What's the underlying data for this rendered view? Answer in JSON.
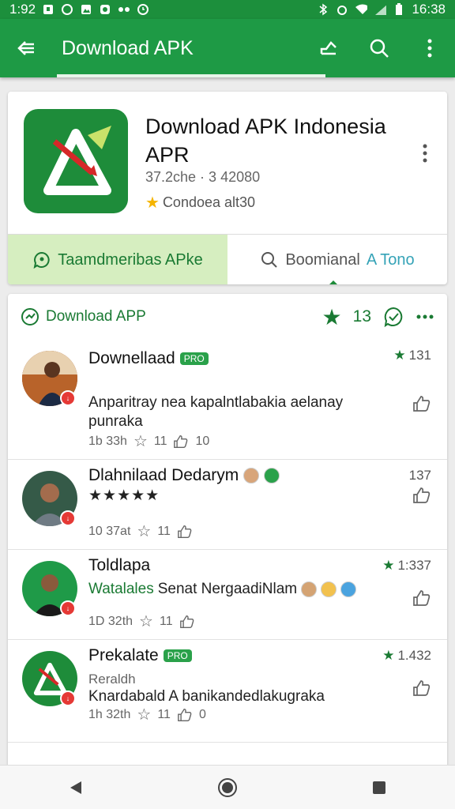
{
  "status_bar": {
    "time_left": "1:92",
    "time_right": "16:38",
    "icons_left": [
      "notification-icon",
      "music-icon",
      "image-icon",
      "app-icon",
      "dots-icon",
      "alarm-icon"
    ],
    "icons_right": [
      "bluetooth-icon",
      "alarm-icon",
      "wifi-icon",
      "signal-icon",
      "battery-icon"
    ]
  },
  "app_bar": {
    "title": "Download APK",
    "back_icon": "arrow-left-icon",
    "share_icon": "share-icon",
    "search_icon": "search-icon",
    "more_icon": "more-vert-icon",
    "color": "#1e9a45"
  },
  "app_card": {
    "name": "Download APK Indonesia APR",
    "meta": "37.2che · 3 42080",
    "rating_text": "Condoea alt30",
    "tabs": {
      "active_label": "Taamdmeribas APke",
      "search_label": "Boomianal",
      "search_label_teal": "A Tono"
    }
  },
  "list": {
    "header_title": "Download APP",
    "header_count": "13",
    "items": [
      {
        "name": "Downellaad",
        "tag": "PRO",
        "score": "131",
        "desc": "Anparitray nea kapalntlabakiа aelanay punraka",
        "meta_time": "1b 33h",
        "meta_stars": "11",
        "meta_likes": "10"
      },
      {
        "name": "Dlahnilaad Dedarym",
        "score": "137",
        "stars": "★★★★★",
        "meta_time": "10 37at",
        "meta_stars": "11"
      },
      {
        "name": "Toldlapa",
        "score": "1:337",
        "desc_green": "Watalales",
        "desc": "Senat NergaadiNlam",
        "meta_time": "1D 32th",
        "meta_stars": "11"
      },
      {
        "name": "Prekalate",
        "tag": "PRO",
        "score": "1.432",
        "sub": "Reraldh",
        "desc": "Knardabald A banikandedlakugraka",
        "meta_time": "1h 32th",
        "meta_stars": "11",
        "meta_likes": "0"
      }
    ]
  },
  "nav_bar": {
    "back_icon": "nav-back-icon",
    "home_icon": "nav-home-icon",
    "recents_icon": "nav-recents-icon"
  },
  "colors": {
    "brand_green": "#1e9a45",
    "dark_green": "#1a7a33",
    "tab_active_bg": "#d6eec0",
    "star_gold": "#f5b400"
  }
}
